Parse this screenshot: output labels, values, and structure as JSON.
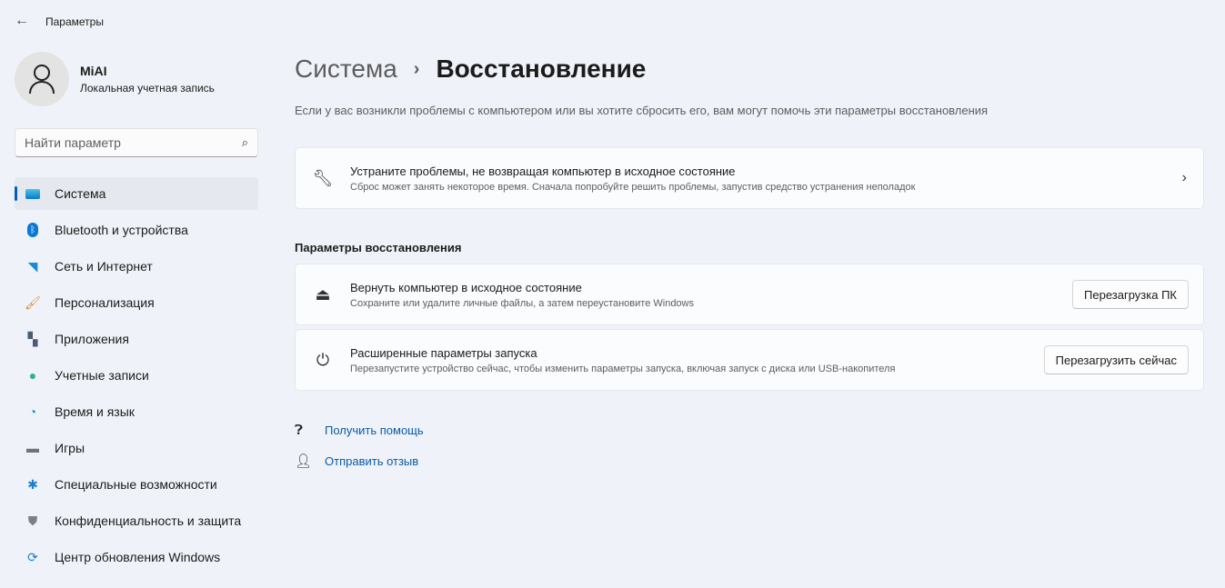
{
  "window": {
    "title": "Параметры"
  },
  "profile": {
    "name": "MiAI",
    "account_type": "Локальная учетная запись"
  },
  "search": {
    "placeholder": "Найти параметр"
  },
  "sidebar": {
    "items": [
      {
        "label": "Система",
        "icon": "system-icon",
        "active": true
      },
      {
        "label": "Bluetooth и устройства",
        "icon": "bluetooth-icon"
      },
      {
        "label": "Сеть и Интернет",
        "icon": "wifi-icon"
      },
      {
        "label": "Персонализация",
        "icon": "brush-icon"
      },
      {
        "label": "Приложения",
        "icon": "apps-icon"
      },
      {
        "label": "Учетные записи",
        "icon": "accounts-icon"
      },
      {
        "label": "Время и язык",
        "icon": "time-language-icon"
      },
      {
        "label": "Игры",
        "icon": "gamepad-icon"
      },
      {
        "label": "Специальные возможности",
        "icon": "accessibility-icon"
      },
      {
        "label": "Конфиденциальность и защита",
        "icon": "shield-icon"
      },
      {
        "label": "Центр обновления Windows",
        "icon": "update-icon"
      }
    ]
  },
  "breadcrumb": {
    "parent": "Система",
    "separator": "›",
    "current": "Восстановление"
  },
  "description": "Если у вас возникли проблемы с компьютером или вы хотите сбросить его, вам могут помочь эти параметры восстановления",
  "troubleshoot": {
    "title": "Устраните проблемы, не возвращая компьютер в исходное состояние",
    "subtitle": "Сброс может занять некоторое время. Сначала попробуйте решить проблемы, запустив средство устранения неполадок"
  },
  "recovery": {
    "heading": "Параметры восстановления",
    "reset": {
      "title": "Вернуть компьютер в исходное состояние",
      "subtitle": "Сохраните или удалите личные файлы, а затем переустановите Windows",
      "button": "Перезагрузка ПК"
    },
    "advanced": {
      "title": "Расширенные параметры запуска",
      "subtitle": "Перезапустите устройство сейчас, чтобы изменить параметры запуска, включая запуск с диска или USB-накопителя",
      "button": "Перезагрузить сейчас"
    }
  },
  "links": {
    "help": "Получить помощь",
    "feedback": "Отправить отзыв"
  }
}
